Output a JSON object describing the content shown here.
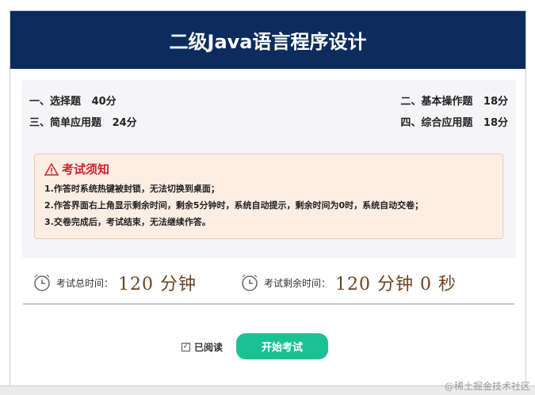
{
  "header": {
    "title": "二级Java语言程序设计"
  },
  "scores": [
    {
      "label": "一、选择题",
      "points": "40分"
    },
    {
      "label": "二、基本操作题",
      "points": "18分"
    },
    {
      "label": "三、简单应用题",
      "points": "24分"
    },
    {
      "label": "四、综合应用题",
      "points": "18分"
    }
  ],
  "notice": {
    "title": "考试须知",
    "lines": [
      "1.作答时系统热键被封锁，无法切换到桌面；",
      "2.作答界面右上角显示剩余时间，剩余5分钟时，系统自动提示，剩余时间为0时，系统自动交卷；",
      "3.交卷完成后，考试结束，无法继续作答。"
    ]
  },
  "timers": {
    "total_label": "考试总时间：",
    "total_value": "120 分钟",
    "remaining_label": "考试剩余时间：",
    "remaining_value": "120 分钟 0 秒"
  },
  "footer": {
    "read_label": "已阅读",
    "read_checked": true,
    "start_button": "开始考试"
  },
  "watermark": "@稀土掘金技术社区"
}
